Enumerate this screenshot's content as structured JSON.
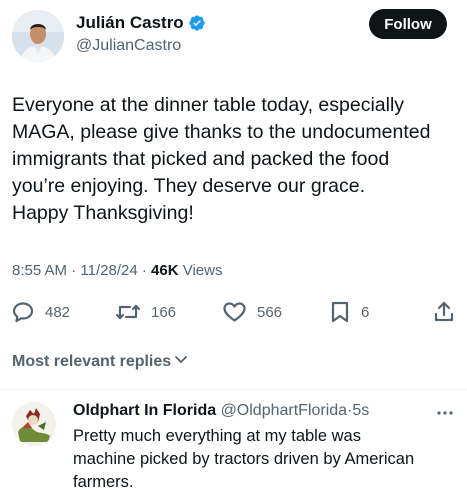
{
  "author": {
    "name": "Julián Castro",
    "handle": "@JulianCastro"
  },
  "follow_label": "Follow",
  "tweet": {
    "lines": [
      "Everyone at the dinner table today, especially",
      "MAGA, please give thanks to the undocumented",
      "immigrants that picked and packed the food",
      "you’re enjoying. They deserve our grace.",
      "Happy Thanksgiving!"
    ],
    "time": "8:55 AM",
    "date": "11/28/24",
    "sep": "·",
    "views_count": "46K",
    "views_label": "Views"
  },
  "actions": {
    "replies": "482",
    "reposts": "166",
    "likes": "566",
    "bookmarks": "6"
  },
  "replies_sort_label": "Most relevant replies",
  "reply": {
    "name": "Oldphart In Florida",
    "handle": "@OldphartFlorida",
    "sep": "·",
    "time": "5s",
    "lines": [
      "Pretty much everything at my table was",
      "machine picked by tractors driven by American",
      "farmers."
    ]
  },
  "colors": {
    "text": "#0f1419",
    "secondary": "#536471",
    "verified": "#1d9bf0",
    "follow_bg": "#0f1419"
  },
  "icons": [
    "verified-badge-icon",
    "reply-icon",
    "repost-icon",
    "like-icon",
    "bookmark-icon",
    "share-icon",
    "chevron-down-icon",
    "more-icon"
  ]
}
